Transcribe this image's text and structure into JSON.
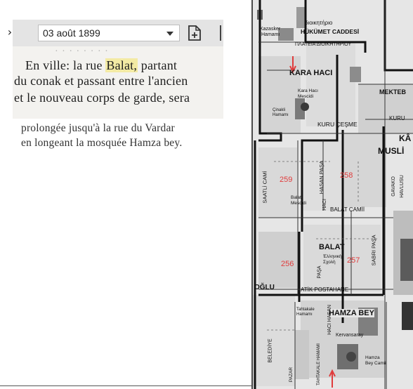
{
  "viewer": {
    "date": "03 août 1899"
  },
  "clipping": {
    "cut_line": "· · · · · · · ·",
    "line1_pre": "En ville: la rue ",
    "line1_highlight": "Balat,",
    "line1_post": " partant",
    "line2": "du conak et passant entre l'ancien",
    "line3": "et le nouveau corps de garde, sera",
    "line4": "prolongée jusqu'à la rue du Vardar",
    "line5": "en longeant la mosquée Hamza bey."
  },
  "map": {
    "labels": {
      "kazasker": "Kazasker",
      "hamami": "Hamamı",
      "greek_top": "διοικητήριο",
      "hukumet": "HÜKÜMET CADDESİ",
      "greek_square": "ΠΛΑΤΕΙΑ ΔΙΟΙΚΗΤΗΡΙΟΥ",
      "kara_haci": "KARA HACI",
      "kara_haci_mescidi": "Kara Hacı Mescidi",
      "mekteb": "MEKTEB",
      "kuru_cesme": "KURU ÇEŞME",
      "kuru": "KURU",
      "ka": "KÂ",
      "musli": "MUSLİ",
      "sinakhane": "Çinakli Hamamı",
      "saatli_cami": "SAATLİ CAMİ",
      "hasan_pasa": "HASAN PAŞA",
      "haci": "HACI",
      "gavako": "GAVAKO",
      "havlusu": "HAVLUSU",
      "balat_mescidi": "Balat Mescidi",
      "balat_camii": "BALAT CAMİİ",
      "balat": "BALAT",
      "greek_school": "Ἑλληνικὴ Σχολὴ",
      "pasa": "PAŞA",
      "sabri_pasa": "SABRI PAŞA",
      "oglu": "OĞLU",
      "atik_postahane": "ATİK POSTAHANE",
      "hamza_bey": "HAMZA BEY",
      "tahtakale": "Tahtakale Hamamı",
      "haci_hasan": "HACI HASAN",
      "kervansaray": "Kervansaray",
      "beledie": "BELEDİYE",
      "tahtakale_hamami": "TAHTAKALE HAMAMI",
      "hamza_bey_camii": "Hamza Bey Camii",
      "pazar": "PAZAR"
    },
    "annotations": [
      "259",
      "258",
      "256",
      "257"
    ],
    "annotation_color": "#e03c3c"
  }
}
